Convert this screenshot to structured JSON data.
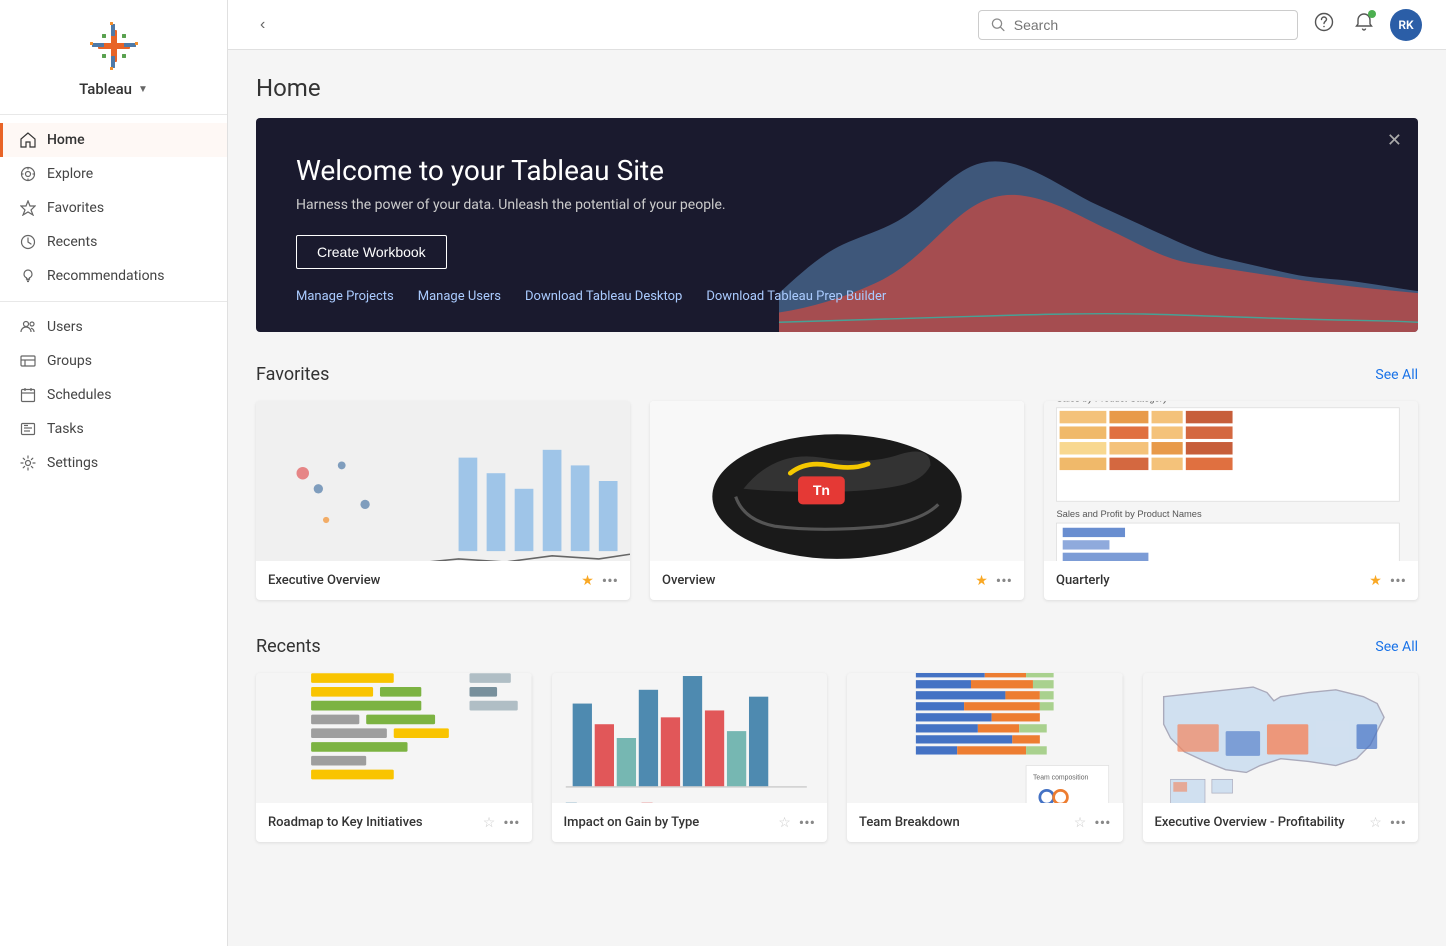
{
  "sidebar": {
    "logo_alt": "Tableau Logo",
    "brand_name": "Tableau",
    "collapse_label": "Collapse sidebar",
    "nav_main": [
      {
        "id": "home",
        "label": "Home",
        "icon": "home-icon",
        "active": true
      },
      {
        "id": "explore",
        "label": "Explore",
        "icon": "explore-icon",
        "active": false
      },
      {
        "id": "favorites",
        "label": "Favorites",
        "icon": "star-icon",
        "active": false
      },
      {
        "id": "recents",
        "label": "Recents",
        "icon": "clock-icon",
        "active": false
      },
      {
        "id": "recommendations",
        "label": "Recommendations",
        "icon": "lightbulb-icon",
        "active": false
      }
    ],
    "nav_admin": [
      {
        "id": "users",
        "label": "Users",
        "icon": "users-icon"
      },
      {
        "id": "groups",
        "label": "Groups",
        "icon": "groups-icon"
      },
      {
        "id": "schedules",
        "label": "Schedules",
        "icon": "schedules-icon"
      },
      {
        "id": "tasks",
        "label": "Tasks",
        "icon": "tasks-icon"
      },
      {
        "id": "settings",
        "label": "Settings",
        "icon": "settings-icon"
      }
    ]
  },
  "topbar": {
    "search_placeholder": "Search",
    "help_label": "Help",
    "notifications_label": "Notifications",
    "avatar_text": "RK",
    "avatar_bg": "#2b5ea7"
  },
  "page": {
    "title": "Home"
  },
  "banner": {
    "title": "Welcome to your Tableau Site",
    "subtitle": "Harness the power of your data. Unleash the potential of your people.",
    "create_workbook_label": "Create Workbook",
    "links": [
      {
        "id": "manage-projects",
        "label": "Manage Projects"
      },
      {
        "id": "manage-users",
        "label": "Manage Users"
      },
      {
        "id": "download-desktop",
        "label": "Download Tableau Desktop"
      },
      {
        "id": "download-prep",
        "label": "Download Tableau Prep Builder"
      }
    ]
  },
  "favorites": {
    "section_title": "Favorites",
    "see_all_label": "See All",
    "items": [
      {
        "id": "executive-overview",
        "name": "Executive Overview",
        "starred": true
      },
      {
        "id": "overview",
        "name": "Overview",
        "starred": true
      },
      {
        "id": "quarterly",
        "name": "Quarterly",
        "starred": true
      }
    ]
  },
  "recents": {
    "section_title": "Recents",
    "see_all_label": "See All",
    "items": [
      {
        "id": "roadmap",
        "name": "Roadmap to Key Initiatives"
      },
      {
        "id": "impact-gain",
        "name": "Impact on Gain by Type"
      },
      {
        "id": "team-breakdown",
        "name": "Team Breakdown"
      },
      {
        "id": "exec-profitability",
        "name": "Executive Overview - Profitability"
      }
    ]
  }
}
